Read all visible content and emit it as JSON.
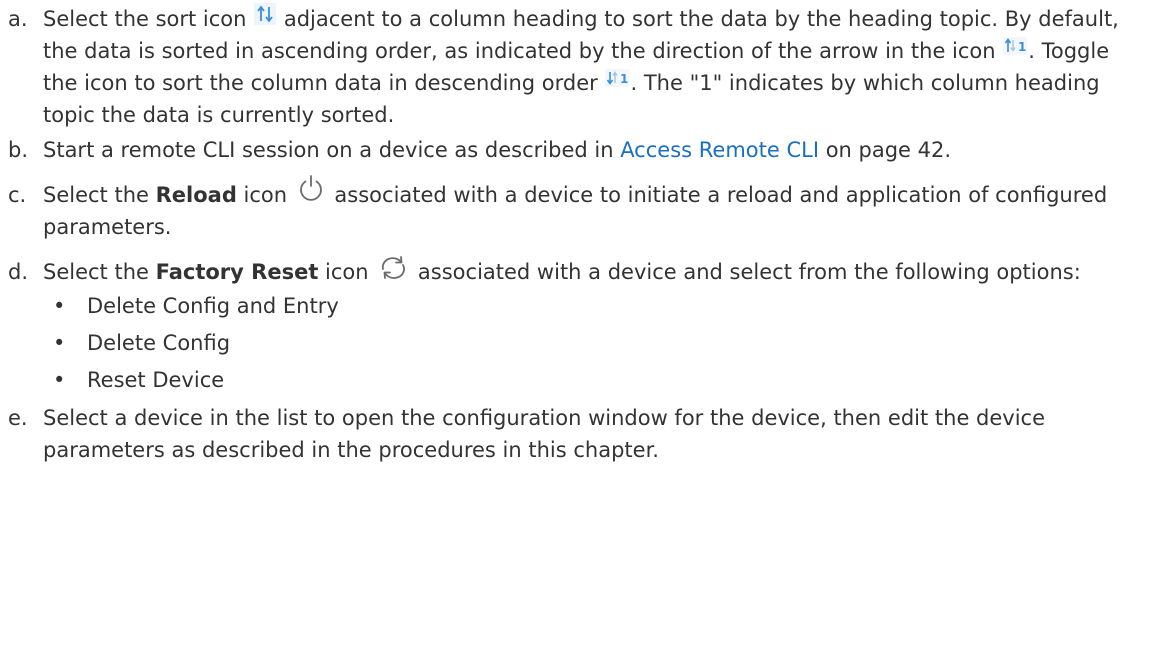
{
  "items": [
    {
      "marker": "a.",
      "text1": "Select the sort icon ",
      "text2": " adjacent to a column heading to sort the data by the heading topic. By default, the data is sorted in ascending order, as indicated by the direction of the arrow in the icon ",
      "text3": ". Toggle the icon to sort the column data in descending order ",
      "text4": ". The \"1\" indicates by which column heading topic the data is currently sorted."
    },
    {
      "marker": "b.",
      "text1": "Start a remote CLI session on a device as described in ",
      "link": "Access Remote CLI",
      "text2": " on page 42."
    },
    {
      "marker": "c.",
      "text1": "Select the ",
      "bold": "Reload",
      "text2": " icon ",
      "text3": " associated with a device to initiate a reload and application of configured parameters."
    },
    {
      "marker": "d.",
      "text1": "Select the ",
      "bold": "Factory Reset",
      "text2": " icon ",
      "text3": " associated with a device and select from the following options:",
      "options": [
        "Delete Config and Entry",
        "Delete Config",
        "Reset Device"
      ],
      "bullet": "•"
    },
    {
      "marker": "e.",
      "text1": "Select a device in the list to open the configuration window for the device, then edit the device parameters as described in the procedures in this chapter."
    }
  ],
  "icon_labels": {
    "sort_ascending_num": "1",
    "sort_descending_num": "1"
  },
  "colors": {
    "text": "#333333",
    "link": "#1a6fc4",
    "icon_blue": "#3b8ed8",
    "icon_gray": "#6b6b6b"
  },
  "icons": {
    "sort": "sort-icon",
    "sort_asc": "sort-ascending-icon",
    "sort_desc": "sort-descending-icon",
    "reload": "power-icon",
    "factory_reset": "refresh-icon"
  }
}
